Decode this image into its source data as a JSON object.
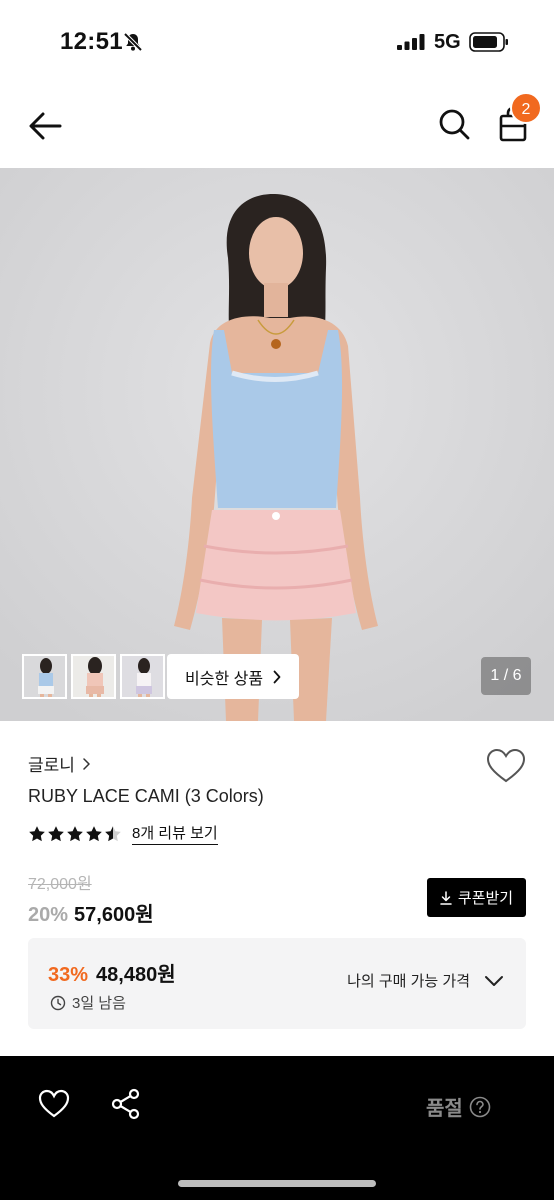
{
  "status_bar": {
    "time": "12:51",
    "network": "5G"
  },
  "header": {
    "cart_count": "2"
  },
  "gallery": {
    "similar_label": "비슷한 상품",
    "page_indicator": "1 / 6"
  },
  "product": {
    "brand": "글로니",
    "name": "RUBY LACE CAMI (3 Colors)",
    "rating": 4.5,
    "review_link": "8개 리뷰 보기",
    "original_price": "72,000원",
    "discount": "20%",
    "sale_price": "57,600원",
    "coupon_label": "쿠폰받기"
  },
  "my_price": {
    "discount": "33%",
    "price": "48,480원",
    "time_left": "3일 남음",
    "label": "나의 구매 가능 가격"
  },
  "bottom_bar": {
    "soldout_label": "품절"
  },
  "colors": {
    "accent": "#f1691f",
    "black": "#000000"
  }
}
